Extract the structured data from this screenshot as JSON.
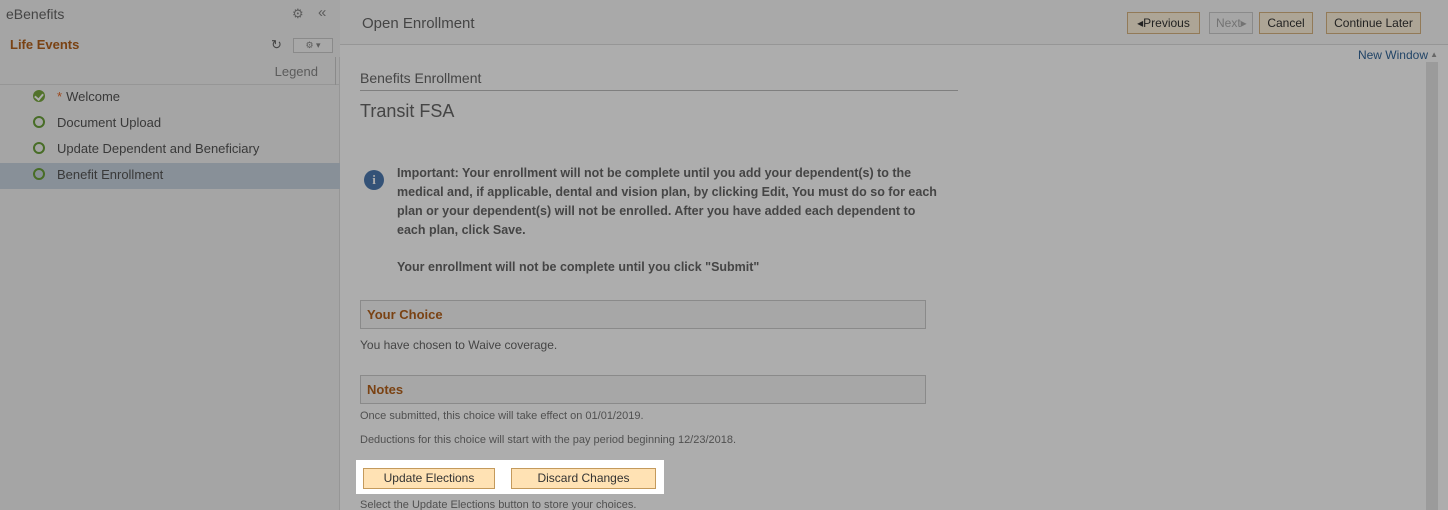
{
  "left_panel": {
    "app_title": "eBenefits",
    "section_title": "Life Events",
    "legend": "Legend",
    "steps": [
      {
        "label": "Welcome",
        "required_marker": "*",
        "status": "complete"
      },
      {
        "label": "Document Upload",
        "status": "open"
      },
      {
        "label": "Update Dependent and Beneficiary",
        "status": "open"
      },
      {
        "label": "Benefit Enrollment",
        "status": "open",
        "selected": true
      }
    ]
  },
  "header": {
    "page_title": "Open Enrollment",
    "previous_label": "◂Previous",
    "next_label": "Next▸",
    "cancel_label": "Cancel",
    "continue_later_label": "Continue Later",
    "new_window": "New Window"
  },
  "content": {
    "breadcrumb": "Benefits Enrollment",
    "section_title": "Transit FSA",
    "info_message": "Important: Your enrollment will not be complete until you add your dependent(s) to the medical and, if applicable, dental and vision plan, by clicking Edit, You must do so for each plan or your dependent(s) will not be enrolled. After you have added each dependent to each plan, click Save.",
    "info_message_2": "Your enrollment will not be complete until you click \"Submit\"",
    "your_choice_title": "Your Choice",
    "your_choice_text": "You have chosen to Waive coverage.",
    "notes_title": "Notes",
    "notes_line_1": "Once submitted, this choice will take effect on 01/01/2019.",
    "notes_line_2": "Deductions for this choice will start with the pay period beginning 12/23/2018.",
    "update_elections_label": "Update Elections",
    "discard_changes_label": "Discard Changes",
    "footer_text": "Select the Update Elections button to store your choices."
  }
}
